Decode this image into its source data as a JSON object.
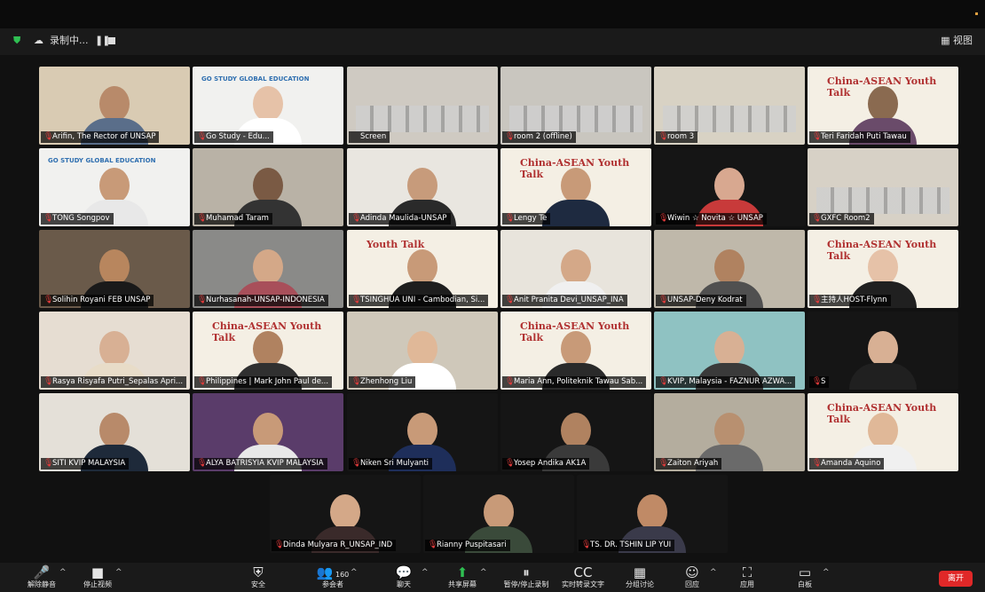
{
  "topbar": {
    "recording_label": "录制中...",
    "pause_glyph": "❚❚",
    "view_label": "视图"
  },
  "participants": [
    {
      "name": "Arifin, The Rector of UNSAP",
      "bg": "#d9cbb3",
      "skin": "#b88a6a",
      "shirt": "#5a6e8a",
      "muted": true,
      "type": "person"
    },
    {
      "name": "Go Study - Edu...",
      "bg": "#f1f1ef",
      "skin": "#e6c2a8",
      "shirt": "#ffffff",
      "muted": true,
      "type": "person",
      "logo": "GO STUDY GLOBAL EDUCATION"
    },
    {
      "name": "Screen",
      "bg": "#cfcac2",
      "muted": false,
      "type": "room",
      "active": true
    },
    {
      "name": "room 2 (offline)",
      "bg": "#c9c6bf",
      "muted": true,
      "type": "room"
    },
    {
      "name": "room 3",
      "bg": "#d8d2c4",
      "muted": true,
      "type": "room"
    },
    {
      "name": "Teri Faridah Puti Tawau",
      "bg": "#f4efe4",
      "skin": "#8a6a50",
      "shirt": "#6a4b6a",
      "muted": true,
      "type": "banner",
      "banner": "China-ASEAN Youth Talk"
    },
    {
      "name": "TONG Songpov",
      "bg": "#f1f1ef",
      "skin": "#c89a78",
      "shirt": "#e8e8e8",
      "muted": true,
      "type": "person",
      "logo": "GO STUDY GLOBAL EDUCATION"
    },
    {
      "name": "Muhamad Taram",
      "bg": "#b9b2a6",
      "skin": "#7a5a44",
      "shirt": "#333333",
      "muted": true,
      "type": "person"
    },
    {
      "name": "Adinda Maulida-UNSAP",
      "bg": "#e9e6e0",
      "skin": "#c79b7b",
      "shirt": "#2a2a2a",
      "muted": true,
      "type": "person"
    },
    {
      "name": "Lengy Te",
      "bg": "#f4efe4",
      "skin": "#c89a78",
      "shirt": "#1e2a40",
      "muted": true,
      "type": "banner",
      "banner": "China-ASEAN Youth Talk"
    },
    {
      "name": "Wiwin ☆ Novita ☆ UNSAP",
      "bg": "#151515",
      "skin": "#d8a890",
      "shirt": "#c83a3a",
      "muted": true,
      "type": "person"
    },
    {
      "name": "GXFC Room2",
      "bg": "#d7d1c6",
      "muted": true,
      "type": "room"
    },
    {
      "name": "Solihin Royani FEB UNSAP",
      "bg": "#6a5a4a",
      "skin": "#b8865e",
      "shirt": "#1a1a1a",
      "muted": true,
      "type": "person"
    },
    {
      "name": "Nurhasanah-UNSAP-INDONESIA",
      "bg": "#8a8a88",
      "skin": "#d4a888",
      "shirt": "#a84f5a",
      "muted": true,
      "type": "person"
    },
    {
      "name": "TSINGHUA UNI - Cambodian, Si...",
      "bg": "#f4efe4",
      "skin": "#c89a78",
      "shirt": "#1e1e1e",
      "muted": true,
      "type": "banner",
      "banner": "Youth Talk"
    },
    {
      "name": "Anit Pranita Devi_UNSAP_INA",
      "bg": "#e8e4dc",
      "skin": "#d4a888",
      "shirt": "#f0f0f0",
      "muted": true,
      "type": "person"
    },
    {
      "name": "UNSAP-Deny Kodrat",
      "bg": "#bfb8aa",
      "skin": "#b08260",
      "shirt": "#505050",
      "muted": true,
      "type": "person"
    },
    {
      "name": "主持人HOST-Flynn",
      "bg": "#f4efe4",
      "skin": "#e6c2a8",
      "shirt": "#202020",
      "muted": true,
      "type": "banner",
      "banner": "China-ASEAN Youth Talk"
    },
    {
      "name": "Rasya Risyafa Putri_Sepalas Apri...",
      "bg": "#e6ddd2",
      "skin": "#d8b094",
      "shirt": "#e8dcc8",
      "muted": true,
      "type": "person"
    },
    {
      "name": "Philippines | Mark John Paul de...",
      "bg": "#f4efe4",
      "skin": "#b08260",
      "shirt": "#303030",
      "muted": true,
      "type": "banner",
      "banner": "China-ASEAN Youth Talk"
    },
    {
      "name": "Zhenhong Liu",
      "bg": "#cfc8ba",
      "skin": "#e0b898",
      "shirt": "#ffffff",
      "muted": true,
      "type": "person"
    },
    {
      "name": "Maria Ann, Politeknik Tawau Sab...",
      "bg": "#f4efe4",
      "skin": "#c89a78",
      "shirt": "#2a2a2a",
      "muted": true,
      "type": "banner",
      "banner": "China-ASEAN Youth Talk"
    },
    {
      "name": "KVIP, Malaysia - FAZNUR AZWA...",
      "bg": "#8fc2c2",
      "skin": "#d8b094",
      "shirt": "#3a3a3a",
      "muted": true,
      "type": "person"
    },
    {
      "name": "S",
      "bg": "#151515",
      "skin": "#d8b094",
      "shirt": "#202020",
      "muted": true,
      "type": "person"
    },
    {
      "name": "SITI KVIP MALAYSIA",
      "bg": "#e4e0d8",
      "skin": "#b88a6a",
      "shirt": "#1e2a3a",
      "muted": true,
      "type": "person"
    },
    {
      "name": "ALYA BATRISYIA KVIP MALAYSIA",
      "bg": "#5a3c6a",
      "skin": "#c89a78",
      "shirt": "#e8e8e8",
      "muted": true,
      "type": "person"
    },
    {
      "name": "Niken Sri Mulyanti",
      "bg": "#151515",
      "skin": "#c89a78",
      "shirt": "#1e2e5a",
      "muted": true,
      "type": "person"
    },
    {
      "name": "Yosep Andika AK1A",
      "bg": "#151515",
      "skin": "#b08260",
      "shirt": "#3a3a3a",
      "muted": true,
      "type": "person"
    },
    {
      "name": "Zaiton Ariyah",
      "bg": "#b4ad9e",
      "skin": "#b89070",
      "shirt": "#6a6a6a",
      "muted": true,
      "type": "person"
    },
    {
      "name": "Amanda Aquino",
      "bg": "#f4efe4",
      "skin": "#e0b898",
      "shirt": "#f0f0f0",
      "muted": true,
      "type": "banner",
      "banner": "China-ASEAN Youth Talk"
    },
    {
      "name": "Dinda Mulyara R_UNSAP_IND",
      "bg": "#151515",
      "skin": "#d4a888",
      "shirt": "#3a2a2a",
      "muted": true,
      "type": "person"
    },
    {
      "name": "Rianny Puspitasari",
      "bg": "#151515",
      "skin": "#c89a78",
      "shirt": "#3a4a3a",
      "muted": true,
      "type": "person"
    },
    {
      "name": "TS. DR. TSHIN LIP YUI",
      "bg": "#151515",
      "skin": "#c08a66",
      "shirt": "#3a3a4a",
      "muted": true,
      "type": "person"
    }
  ],
  "toolbar": {
    "items": [
      {
        "icon": "🎤",
        "label": "解除静音",
        "name": "unmute-button",
        "caret": true
      },
      {
        "icon": "■",
        "label": "停止视频",
        "name": "stop-video-button",
        "caret": true
      },
      {
        "icon": "⛨",
        "label": "安全",
        "name": "security-button",
        "caret": false
      },
      {
        "icon": "👥",
        "label": "参会者",
        "name": "participants-button",
        "caret": true,
        "count": "160"
      },
      {
        "icon": "💬",
        "label": "聊天",
        "name": "chat-button",
        "caret": true
      },
      {
        "icon": "⬆",
        "label": "共享屏幕",
        "name": "share-screen-button",
        "caret": true
      },
      {
        "icon": "⏸",
        "label": "暂停/停止录制",
        "name": "pause-stop-recording-button",
        "caret": false
      },
      {
        "icon": "CC",
        "label": "实时转录文字",
        "name": "live-transcript-button",
        "caret": false
      },
      {
        "icon": "▦",
        "label": "分组讨论",
        "name": "breakout-rooms-button",
        "caret": false
      },
      {
        "icon": "☺",
        "label": "回应",
        "name": "reactions-button",
        "caret": true
      },
      {
        "icon": "⛶",
        "label": "应用",
        "name": "apps-button",
        "caret": false
      },
      {
        "icon": "▭",
        "label": "白板",
        "name": "whiteboard-button",
        "caret": true
      }
    ],
    "leave_label": "离开"
  }
}
